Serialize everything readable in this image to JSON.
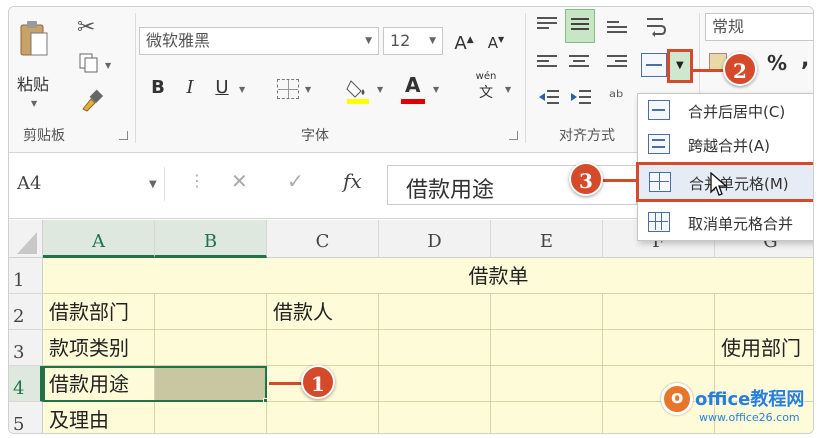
{
  "ribbon": {
    "paste_label": "粘贴",
    "clipboard_group": "剪贴板",
    "font_name": "微软雅黑",
    "font_size": "12",
    "grow_font": "A",
    "shrink_font": "A",
    "bold": "B",
    "italic": "I",
    "underline": "U",
    "font_color_letter": "A",
    "phonetic_top": "wén",
    "phonetic_bottom": "文",
    "font_group": "字体",
    "align_group": "对齐方式",
    "number_format": "常规",
    "percent": "%",
    "comma": ","
  },
  "formula_bar": {
    "name_box": "A4",
    "fx": "fx",
    "cancel": "✕",
    "enter": "✓",
    "content": "借款用途"
  },
  "columns": [
    "A",
    "B",
    "C",
    "D",
    "E",
    "F",
    "G"
  ],
  "rows": [
    "1",
    "2",
    "3",
    "4",
    "5"
  ],
  "cells": {
    "title": "借款单",
    "a2": "借款部门",
    "c2": "借款人",
    "a3": "款项类别",
    "g3": "使用部门",
    "a4": "借款用途",
    "a5": "及理由"
  },
  "merge_menu": {
    "items": [
      {
        "label": "合并后居中(C)"
      },
      {
        "label": "跨越合并(A)"
      },
      {
        "label": "合并单元格(M)"
      },
      {
        "label": "取消单元格合并"
      }
    ]
  },
  "callouts": {
    "one": "1",
    "two": "2",
    "three": "3"
  },
  "watermark": {
    "brand": "office教程网",
    "url": "www.office26.com"
  },
  "colors": {
    "accent_red": "#d54a2a",
    "cell_fill": "#fefbd8",
    "selection_green": "#217346"
  }
}
